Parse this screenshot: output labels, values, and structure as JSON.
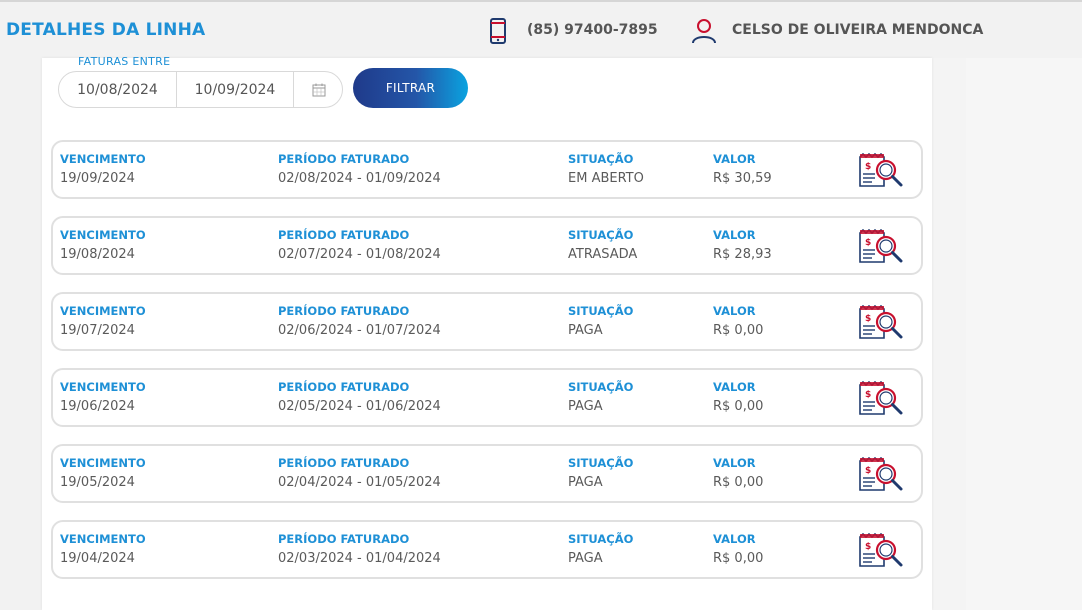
{
  "header": {
    "title": "DETALHES DA LINHA",
    "phone": "(85) 97400-7895",
    "user_name": "CELSO DE OLIVEIRA MENDONCA"
  },
  "filter": {
    "label": "FATURAS ENTRE",
    "date_from": "10/08/2024",
    "date_to": "10/09/2024",
    "button_label": "FILTRAR"
  },
  "columns": {
    "vencimento": "VENCIMENTO",
    "periodo": "PERÍODO FATURADO",
    "situacao": "SITUAÇÃO",
    "valor": "VALOR"
  },
  "invoices": [
    {
      "vencimento": "19/09/2024",
      "periodo": "02/08/2024 - 01/09/2024",
      "situacao": "EM ABERTO",
      "valor": "R$ 30,59"
    },
    {
      "vencimento": "19/08/2024",
      "periodo": "02/07/2024 - 01/08/2024",
      "situacao": "ATRASADA",
      "valor": "R$ 28,93"
    },
    {
      "vencimento": "19/07/2024",
      "periodo": "02/06/2024 - 01/07/2024",
      "situacao": "PAGA",
      "valor": "R$ 0,00"
    },
    {
      "vencimento": "19/06/2024",
      "periodo": "02/05/2024 - 01/06/2024",
      "situacao": "PAGA",
      "valor": "R$ 0,00"
    },
    {
      "vencimento": "19/05/2024",
      "periodo": "02/04/2024 - 01/05/2024",
      "situacao": "PAGA",
      "valor": "R$ 0,00"
    },
    {
      "vencimento": "19/04/2024",
      "periodo": "02/03/2024 - 01/04/2024",
      "situacao": "PAGA",
      "valor": "R$ 0,00"
    }
  ],
  "icons": {
    "phone": "smartphone-icon",
    "user": "user-icon",
    "calendar": "calendar-icon",
    "invoice_action": "invoice-magnifier-icon"
  },
  "colors": {
    "accent": "#1e90d6",
    "icon_red": "#c8102e",
    "icon_navy": "#1f3a6e",
    "button_start": "#1f3a8a",
    "button_end": "#0aa3e0"
  }
}
